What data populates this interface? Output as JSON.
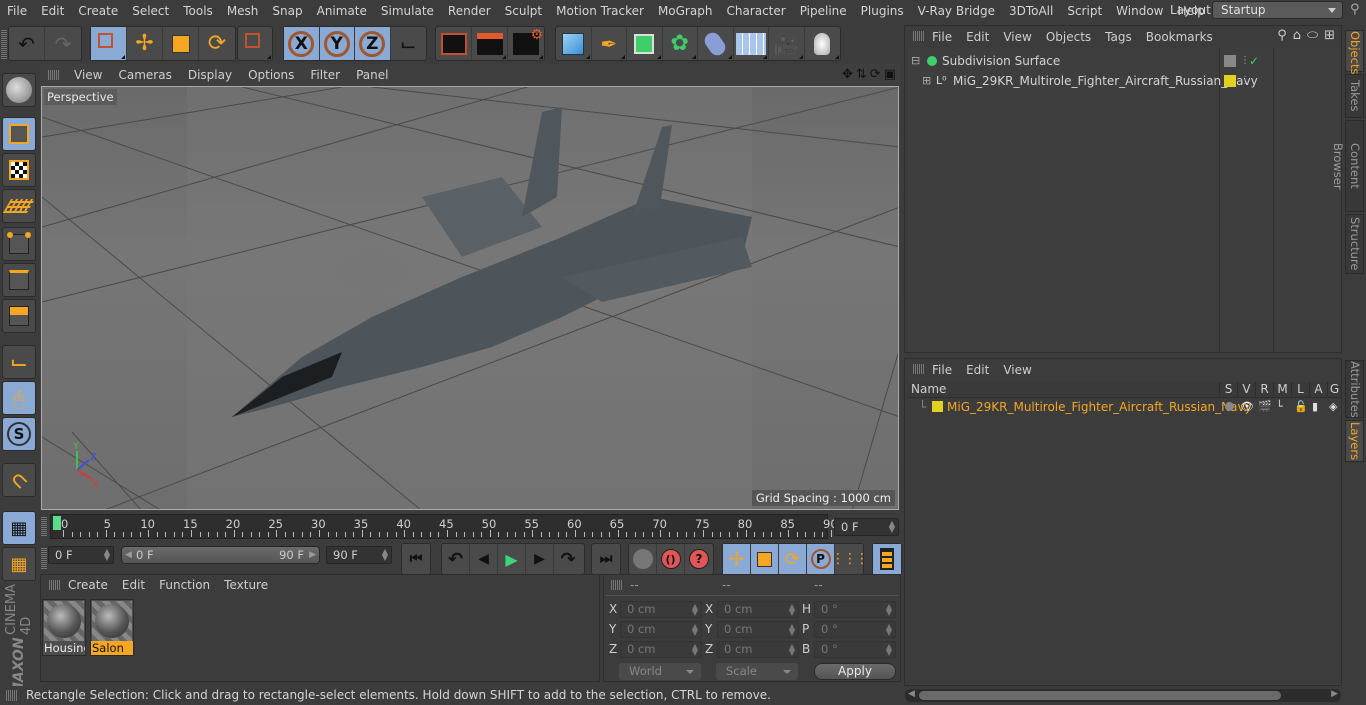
{
  "app": {
    "name": "Cinema 4D",
    "brand_lines": [
      "MAXON",
      "CINEMA 4D"
    ]
  },
  "menubar": {
    "items": [
      "File",
      "Edit",
      "Create",
      "Select",
      "Tools",
      "Mesh",
      "Snap",
      "Animate",
      "Simulate",
      "Render",
      "Sculpt",
      "Motion Tracker",
      "MoGraph",
      "Character",
      "Pipeline",
      "Plugins",
      "V-Ray Bridge",
      "3DToAll",
      "Script",
      "Window",
      "Help"
    ],
    "layout_label": "Layout:",
    "layout_value": "Startup"
  },
  "toolbar": {
    "groups": [
      [
        "undo-icon",
        "redo-icon"
      ],
      [
        "rectangle-selection-icon",
        "move-icon",
        "scale-icon",
        "rotate-icon"
      ],
      [
        "live-selection-icon"
      ],
      [
        "x-axis-lock-icon",
        "y-axis-lock-icon",
        "z-axis-lock-icon",
        "world-coordinates-icon"
      ],
      [
        "render-view-icon",
        "render-to-picture-viewer-icon",
        "render-settings-icon"
      ],
      [
        "cube-icon",
        "pen-icon",
        "subdivision-surface-icon",
        "cloner-icon",
        "bend-deformer-icon",
        "floor-icon",
        "camera-icon",
        "light-icon"
      ]
    ]
  },
  "left_tools": [
    "make-editable-icon",
    "model-mode-icon",
    "texture-mode-icon",
    "workplane-mode-icon",
    "points-mode-icon",
    "edges-mode-icon",
    "polygons-mode-icon",
    "axis-mode-icon",
    "tweak-mode-icon",
    "solo-mode-icon",
    "snapping-icon",
    "workplane-lock-icon",
    "locked-workplane-icon"
  ],
  "viewport": {
    "menu": [
      "View",
      "Cameras",
      "Display",
      "Options",
      "Filter",
      "Panel"
    ],
    "camera_label": "Perspective",
    "grid_spacing": "Grid Spacing : 1000 cm",
    "axis_labels": {
      "x": "X",
      "y": "Y",
      "z": "Z"
    }
  },
  "timeline": {
    "ticks": [
      "0",
      "5",
      "10",
      "15",
      "20",
      "25",
      "30",
      "35",
      "40",
      "45",
      "50",
      "55",
      "60",
      "65",
      "70",
      "75",
      "80",
      "85",
      "90"
    ],
    "current_frame": "0 F",
    "start_field": "0 F",
    "range_start": "0 F",
    "range_end": "90 F",
    "end_field": "90 F"
  },
  "playback": {
    "buttons": [
      "go-to-start-icon",
      "previous-key-icon",
      "previous-frame-icon",
      "play-icon",
      "next-frame-icon",
      "next-key-icon",
      "go-to-end-icon"
    ],
    "key_buttons": [
      "record-active-objects-icon",
      "autokeying-icon",
      "keyframe-selection-icon"
    ],
    "key_tracks": [
      "position-track-icon",
      "scale-track-icon",
      "rotation-track-icon",
      "parameter-track-icon",
      "point-level-animation-icon"
    ],
    "timeline_button": "timeline-icon"
  },
  "materials": {
    "menu": [
      "Create",
      "Edit",
      "Function",
      "Texture"
    ],
    "items": [
      {
        "name": "Housing",
        "selected": false
      },
      {
        "name": "Salon",
        "selected": true
      }
    ]
  },
  "coordinates": {
    "headers": [
      "--",
      "--",
      "--"
    ],
    "rows": [
      {
        "l1": "X",
        "v1": "0 cm",
        "l2": "X",
        "v2": "0 cm",
        "l3": "H",
        "v3": "0 °"
      },
      {
        "l1": "Y",
        "v1": "0 cm",
        "l2": "Y",
        "v2": "0 cm",
        "l3": "P",
        "v3": "0 °"
      },
      {
        "l1": "Z",
        "v1": "0 cm",
        "l2": "Z",
        "v2": "0 cm",
        "l3": "B",
        "v3": "0 °"
      }
    ],
    "mode": "World",
    "transform": "Scale",
    "apply": "Apply"
  },
  "status": "Rectangle Selection: Click and drag to rectangle-select elements. Hold down SHIFT to add to the selection, CTRL to remove.",
  "objects_panel": {
    "menu": [
      "File",
      "Edit",
      "View",
      "Objects",
      "Tags",
      "Bookmarks"
    ],
    "objects": [
      {
        "name": "Subdivision Surface",
        "expanded": true
      },
      {
        "name": "MiG_29KR_Multirole_Fighter_Aircraft_Russian_Navy",
        "expanded": false,
        "layer_color": "#e0d21e"
      }
    ]
  },
  "layers_panel": {
    "menu": [
      "File",
      "Edit",
      "View"
    ],
    "columns": [
      "Name",
      "S",
      "V",
      "R",
      "M",
      "L",
      "A",
      "G"
    ],
    "layers": [
      {
        "name": "MiG_29KR_Multirole_Fighter_Aircraft_Russian_Navy",
        "color": "#e0d21e"
      }
    ]
  },
  "side_tabs_top": [
    {
      "label": "Objects",
      "active": true
    },
    {
      "label": "Takes",
      "active": false
    },
    {
      "label": "Content Browser",
      "active": false
    },
    {
      "label": "Structure",
      "active": false
    }
  ],
  "side_tabs_bottom": [
    {
      "label": "Attributes",
      "active": false
    },
    {
      "label": "Layers",
      "active": true
    }
  ],
  "colors": {
    "accent": "#f5a623",
    "active_button": "#8aa9d4",
    "playhead": "#5bdc8a",
    "layer_text": "#f5a623"
  }
}
